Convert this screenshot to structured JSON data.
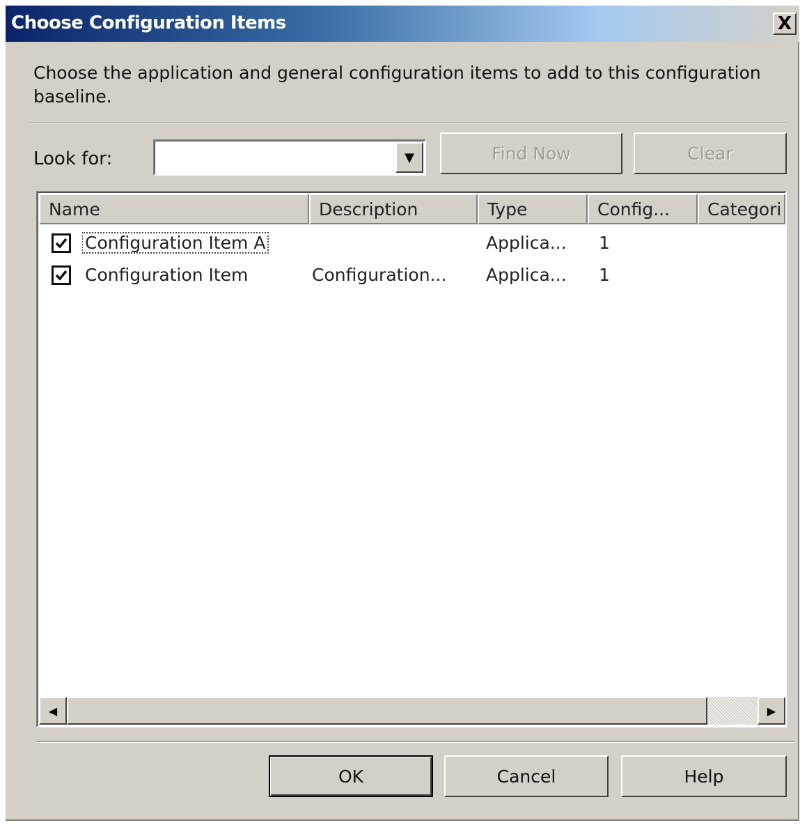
{
  "window": {
    "title": "Choose Configuration Items",
    "close_label": "X"
  },
  "instructions": "Choose the application and general configuration items to add to this configuration baseline.",
  "search": {
    "label": "Look for:",
    "value": "",
    "placeholder": "",
    "find_now_label": "Find Now",
    "clear_label": "Clear"
  },
  "list": {
    "columns": [
      "Name",
      "Description",
      "Type",
      "Config...",
      "Categori"
    ],
    "rows": [
      {
        "checked": true,
        "name": "Configuration Item A",
        "description": "",
        "type": "Applica...",
        "config": "1"
      },
      {
        "checked": true,
        "name": "Configuration Item",
        "description": "Configuration...",
        "type": "Applica...",
        "config": "1"
      }
    ]
  },
  "footer": {
    "ok_label": "OK",
    "cancel_label": "Cancel",
    "help_label": "Help"
  },
  "icons": {
    "dropdown": "chevron-down-icon",
    "checkbox": "checkmark-icon",
    "scroll_left": "arrow-left-icon",
    "scroll_right": "arrow-right-icon"
  },
  "colors": {
    "titlebar_start": "#0a246a",
    "titlebar_end": "#d4d0c8",
    "dialog_face": "#d4d0c8"
  }
}
